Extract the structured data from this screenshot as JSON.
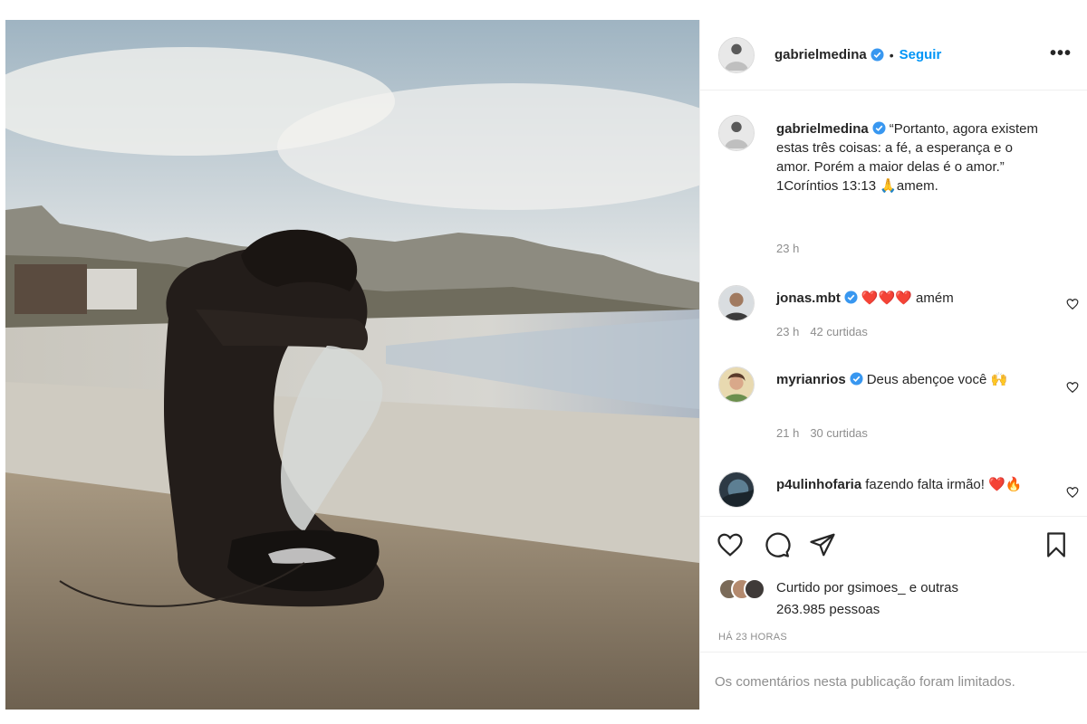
{
  "post": {
    "photo_icon": "surfer-beach-photo",
    "author": {
      "username": "gabrielmedina",
      "verified": true,
      "follow_label": "Seguir",
      "separator": "•",
      "more_label": "•••"
    },
    "caption": {
      "username": "gabrielmedina",
      "text": "“Portanto, agora existem estas três coisas: a fé, a esperança e o amor. Porém a maior delas é o amor.”",
      "text_line2": "1Coríntios 13:13 🙏amem.",
      "time": "23 h"
    },
    "comments": [
      {
        "username": "jonas.mbt",
        "verified": true,
        "text": "❤️❤️❤️ amém",
        "time": "23 h",
        "likes": "42 curtidas"
      },
      {
        "username": "myrianrios",
        "verified": true,
        "text": "Deus abençoe você 🙌",
        "time": "21 h",
        "likes": "30 curtidas"
      },
      {
        "username": "p4ulinhofaria",
        "verified": false,
        "text": "fazendo falta irmão! ❤️🔥"
      }
    ],
    "actions": {
      "like_icon": "heart-icon",
      "comment_icon": "comment-icon",
      "share_icon": "paper-plane-icon",
      "save_icon": "bookmark-icon"
    },
    "liked_by": {
      "prefix": "Curtido por",
      "user": "gsimoes_",
      "suffix": "e outras 263.985 pessoas"
    },
    "post_time": "HÁ 23 HORAS",
    "comments_limited": "Os comentários nesta publicação foram limitados."
  },
  "colors": {
    "link_blue": "#0095f6",
    "verified_blue": "#3897f0",
    "muted_gray": "#8e8e8e",
    "border": "#efefef",
    "heart_red": "#ed4956"
  }
}
